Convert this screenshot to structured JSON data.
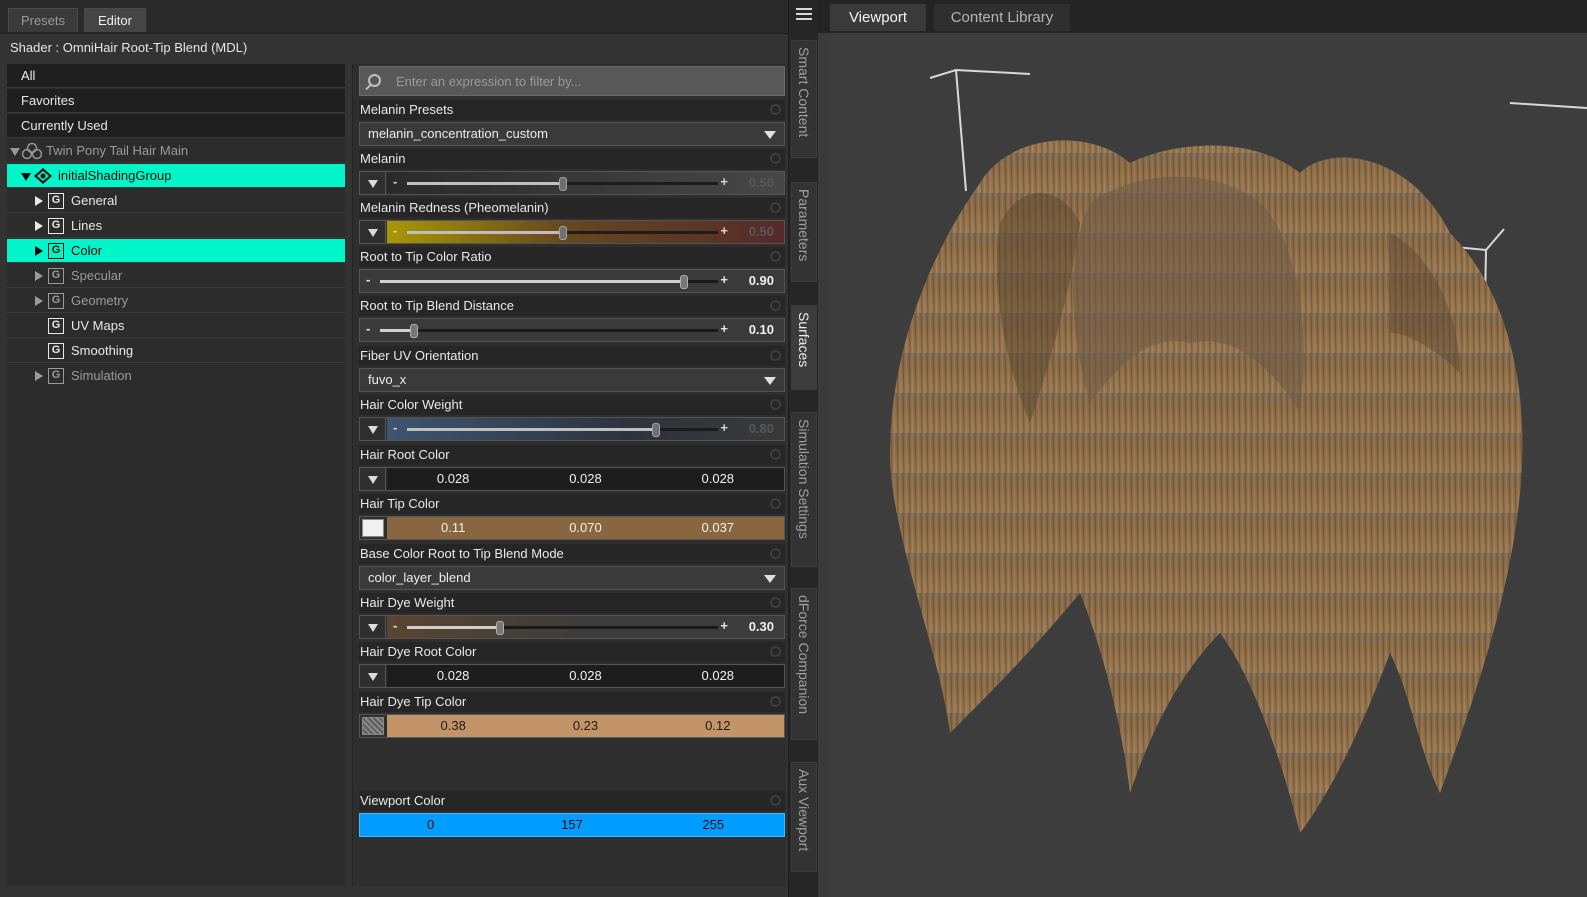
{
  "left_tabs": [
    "Presets",
    "Editor"
  ],
  "shader_line": "Shader :  OmniHair Root-Tip Blend (MDL)",
  "tree": {
    "categories": [
      "All",
      "Favorites",
      "Currently Used"
    ],
    "figure": "Twin Pony Tail Hair Main",
    "group": "initialShadingGroup",
    "nodes": [
      "General",
      "Lines",
      "Color",
      "Specular",
      "Geometry",
      "UV Maps",
      "Smoothing",
      "Simulation"
    ],
    "selected_node": "Color",
    "g_glyph": "G"
  },
  "search": {
    "placeholder": "Enter an expression to filter by..."
  },
  "props": {
    "melanin_presets": {
      "label": "Melanin Presets",
      "value": "melanin_concentration_custom"
    },
    "melanin": {
      "label": "Melanin",
      "value": "0.50",
      "fraction": 0.5,
      "enabled": false
    },
    "melanin_redness": {
      "label": "Melanin Redness (Pheomelanin)",
      "value": "0.50",
      "fraction": 0.5,
      "enabled": false
    },
    "root_tip_ratio": {
      "label": "Root to Tip Color Ratio",
      "value": "0.90",
      "fraction": 0.9,
      "enabled": true
    },
    "root_tip_blend": {
      "label": "Root to Tip Blend Distance",
      "value": "0.10",
      "fraction": 0.1,
      "enabled": true
    },
    "fiber_uv": {
      "label": "Fiber UV Orientation",
      "value": "fuvo_x"
    },
    "hair_color_weight": {
      "label": "Hair Color Weight",
      "value": "0.80",
      "fraction": 0.8,
      "enabled": false
    },
    "hair_root_color": {
      "label": "Hair Root Color",
      "values": [
        "0.028",
        "0.028",
        "0.028"
      ]
    },
    "hair_tip_color": {
      "label": "Hair Tip Color",
      "values": [
        "0.11",
        "0.070",
        "0.037"
      ]
    },
    "blend_mode": {
      "label": "Base Color Root to Tip Blend Mode",
      "value": "color_layer_blend"
    },
    "hair_dye_weight": {
      "label": "Hair Dye Weight",
      "value": "0.30",
      "fraction": 0.3,
      "enabled": true
    },
    "dye_root_color": {
      "label": "Hair Dye Root Color",
      "values": [
        "0.028",
        "0.028",
        "0.028"
      ]
    },
    "dye_tip_color": {
      "label": "Hair Dye Tip Color",
      "values": [
        "0.38",
        "0.23",
        "0.12"
      ]
    },
    "viewport_color": {
      "label": "Viewport Color",
      "values": [
        "0",
        "157",
        "255"
      ]
    }
  },
  "side_tabs": [
    "Smart Content",
    "Parameters",
    "Surfaces",
    "Simulation Settings",
    "dForce Companion",
    "Aux Viewport"
  ],
  "active_side_tab": "Surfaces",
  "right_tabs": [
    "Viewport",
    "Content Library"
  ],
  "colors": {
    "selection": "#00f5c8",
    "tip_swatch": "#8a6640",
    "dye_tip_swatch": "#c29468",
    "viewport_blue": "#009dff",
    "redness_yellow": "#b8a300",
    "hair_base": "#8a6a45"
  },
  "icons": {
    "search": "magnifier-icon",
    "menu": "hamburger-menu-icon",
    "figure": "figure-node-icon",
    "group": "shading-group-icon"
  }
}
